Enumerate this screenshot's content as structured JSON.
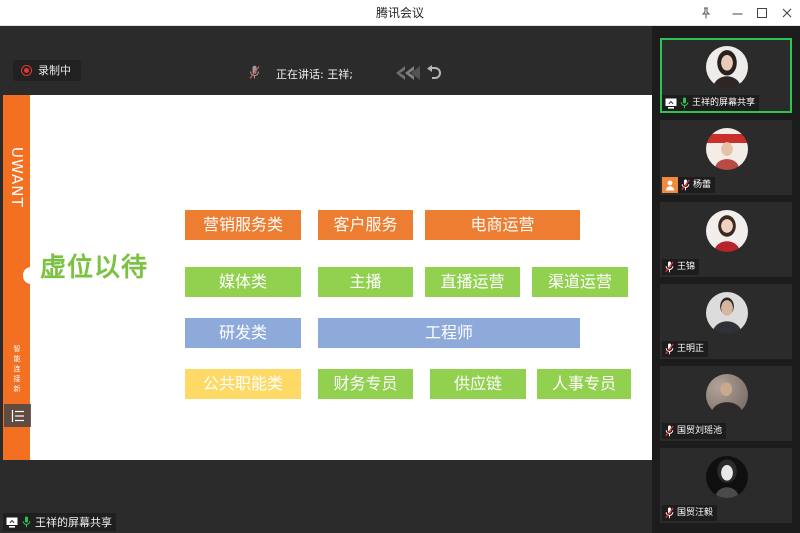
{
  "window": {
    "title": "腾讯会议",
    "icons": {
      "pin": "pin-icon",
      "minimize": "minimize-icon",
      "maximize": "maximize-icon",
      "close": "close-icon"
    }
  },
  "toolbar": {
    "recording_icon": "record-icon",
    "recording_label": "录制中",
    "speaking_icon": "mic-icon",
    "speaking_label": "正在讲话: 王祥;",
    "annotation_icons": [
      "double-chevron-left-icon",
      "undo-icon"
    ]
  },
  "slide": {
    "brand": "UWANT",
    "slogan": "智能连接新",
    "menu_icon": "menu-list-icon",
    "headline": "虚位以待",
    "colors": {
      "brand_bar": "#f36f21",
      "headline": "#7cc242",
      "orange": "#ed7d31",
      "green": "#92d050",
      "blue": "#8eaadb",
      "yellow": "#ffd966"
    },
    "rows": [
      [
        {
          "label": "营销服务类",
          "color": "#ed7d31"
        },
        {
          "label": "客户服务",
          "color": "#ed7d31"
        },
        {
          "label": "电商运营",
          "color": "#ed7d31"
        }
      ],
      [
        {
          "label": "媒体类",
          "color": "#92d050"
        },
        {
          "label": "主播",
          "color": "#92d050"
        },
        {
          "label": "直播运营",
          "color": "#92d050"
        },
        {
          "label": "渠道运营",
          "color": "#92d050"
        }
      ],
      [
        {
          "label": "研发类",
          "color": "#8eaadb"
        },
        {
          "label": "工程师",
          "color": "#8eaadb"
        }
      ],
      [
        {
          "label": "公共职能类",
          "color": "#ffd966"
        },
        {
          "label": "财务专员",
          "color": "#92d050"
        },
        {
          "label": "供应链",
          "color": "#92d050"
        },
        {
          "label": "人事专员",
          "color": "#92d050"
        }
      ]
    ]
  },
  "share": {
    "label": "王祥的屏幕共享",
    "icons": [
      "screen-share-icon",
      "mic-on-icon"
    ]
  },
  "participants": [
    {
      "name": "王祥的屏幕共享",
      "mic": "mic-on-icon",
      "badge": "screen-share-icon",
      "active": true
    },
    {
      "name": "杨蕾",
      "mic": "mic-muted-icon",
      "badge": "person-icon"
    },
    {
      "name": "王锦",
      "mic": "mic-muted-icon"
    },
    {
      "name": "王明正",
      "mic": "mic-muted-icon"
    },
    {
      "name": "国贸刘瑶池",
      "mic": "mic-muted-icon"
    },
    {
      "name": "国贸汪毅",
      "mic": "mic-muted-icon"
    }
  ],
  "accents": {
    "active_border": "#2ec455",
    "mic_on": "#2ec455",
    "mic_muted_slash": "#e5362f",
    "record": "#e5362f",
    "person_badge": "#f08a3c"
  }
}
